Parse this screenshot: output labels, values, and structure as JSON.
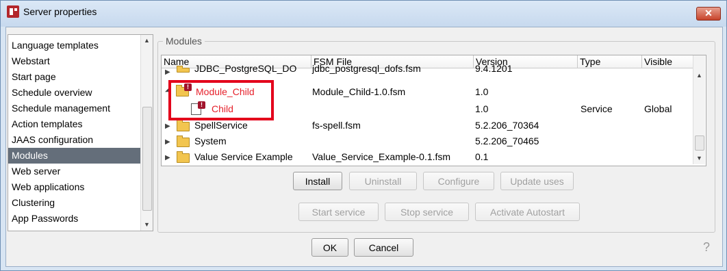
{
  "window": {
    "title": "Server properties",
    "close_label": "✕"
  },
  "nav": {
    "items": [
      {
        "label": "Language templates",
        "selected": false
      },
      {
        "label": "Webstart",
        "selected": false
      },
      {
        "label": "Start page",
        "selected": false
      },
      {
        "label": "Schedule overview",
        "selected": false
      },
      {
        "label": "Schedule management",
        "selected": false
      },
      {
        "label": "Action templates",
        "selected": false
      },
      {
        "label": "JAAS configuration",
        "selected": false
      },
      {
        "label": "Modules",
        "selected": true
      },
      {
        "label": "Web server",
        "selected": false
      },
      {
        "label": "Web applications",
        "selected": false
      },
      {
        "label": "Clustering",
        "selected": false
      },
      {
        "label": "App Passwords",
        "selected": false
      }
    ]
  },
  "modules": {
    "group_title": "Modules",
    "columns": [
      "Name",
      "FSM File",
      "Version",
      "Type",
      "Visible"
    ],
    "rows": [
      {
        "name": "JDBC_PostgreSQL_DO",
        "fsm": "jdbc_postgresql_dofs.fsm",
        "version": "9.4.1201",
        "type": "",
        "visible": "",
        "icon": "folder-icon",
        "expander": "collapsed"
      },
      {
        "name": "Module_Child",
        "fsm": "Module_Child-1.0.fsm",
        "version": "1.0",
        "type": "",
        "visible": "",
        "icon": "folder-error-icon",
        "expander": "expanded",
        "error": true
      },
      {
        "name": "Child",
        "fsm": "",
        "version": "1.0",
        "type": "Service",
        "visible": "Global",
        "icon": "component-error-icon",
        "expander": "",
        "error": true
      },
      {
        "name": "SpellService",
        "fsm": "fs-spell.fsm",
        "version": "5.2.206_70364",
        "type": "",
        "visible": "",
        "icon": "folder-icon",
        "expander": "collapsed"
      },
      {
        "name": "System",
        "fsm": "",
        "version": "5.2.206_70465",
        "type": "",
        "visible": "",
        "icon": "folder-icon",
        "expander": "collapsed"
      },
      {
        "name": "Value Service Example",
        "fsm": "Value_Service_Example-0.1.fsm",
        "version": "0.1",
        "type": "",
        "visible": "",
        "icon": "folder-icon",
        "expander": "collapsed"
      }
    ]
  },
  "buttons": {
    "install": "Install",
    "uninstall": "Uninstall",
    "configure": "Configure",
    "update_uses": "Update uses",
    "start_service": "Start service",
    "stop_service": "Stop service",
    "activate_autostart": "Activate Autostart",
    "ok": "OK",
    "cancel": "Cancel"
  },
  "help": {
    "label": "?"
  },
  "colors": {
    "error": "#e6202b",
    "selected_nav": "#646e7a",
    "highlight_border": "#e3001b"
  }
}
